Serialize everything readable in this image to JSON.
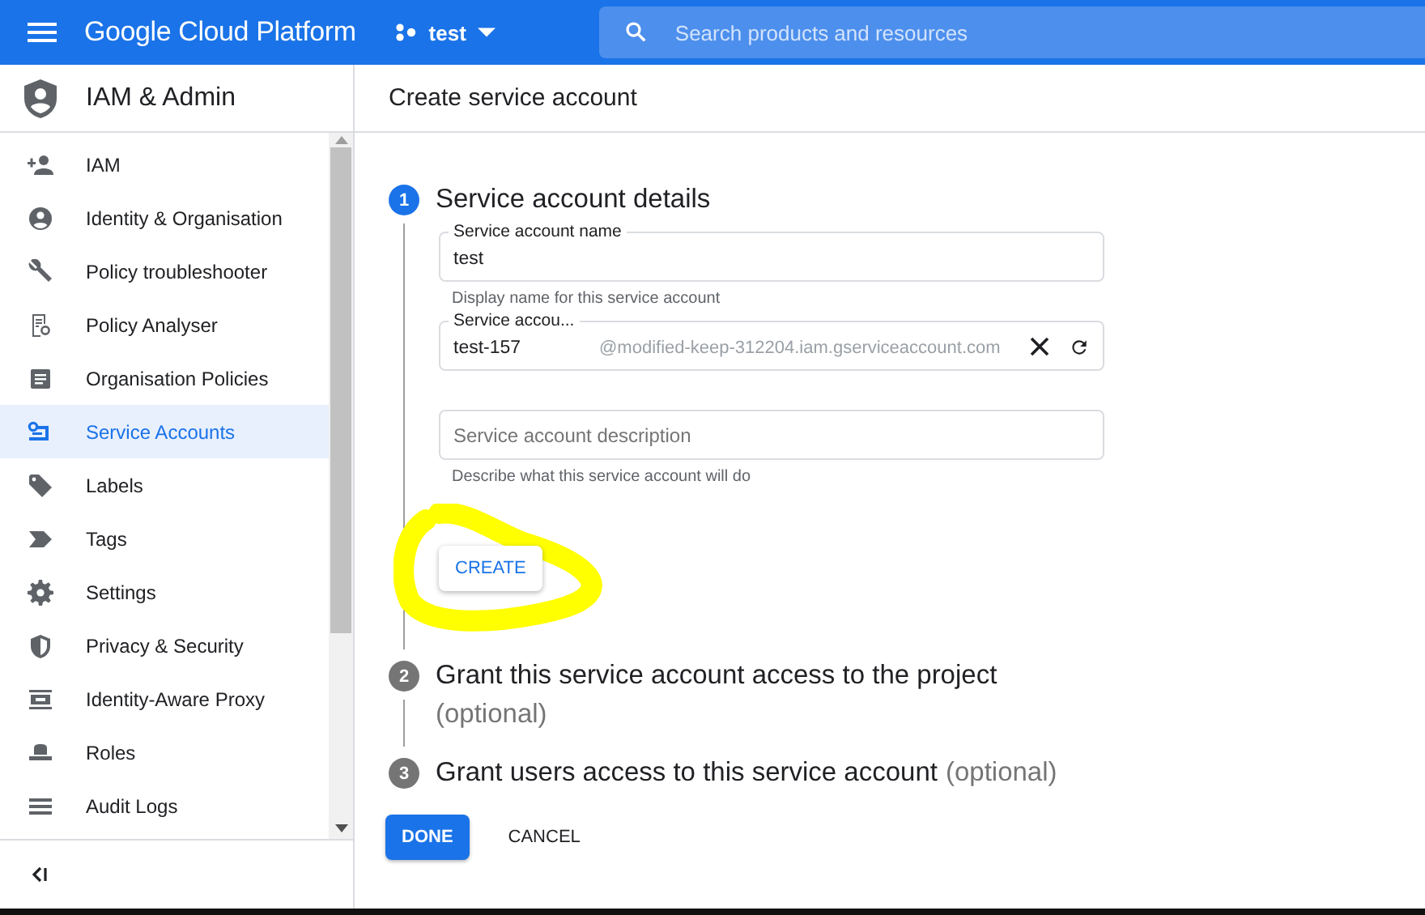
{
  "topbar": {
    "product": "Google Cloud Platform",
    "project": "test",
    "search": {
      "placeholder": "Search products and resources"
    }
  },
  "sidebar": {
    "title": "IAM & Admin",
    "items": [
      {
        "label": "IAM",
        "selected": false
      },
      {
        "label": "Identity & Organisation",
        "selected": false
      },
      {
        "label": "Policy troubleshooter",
        "selected": false
      },
      {
        "label": "Policy Analyser",
        "selected": false
      },
      {
        "label": "Organisation Policies",
        "selected": false
      },
      {
        "label": "Service Accounts",
        "selected": true
      },
      {
        "label": "Labels",
        "selected": false
      },
      {
        "label": "Tags",
        "selected": false
      },
      {
        "label": "Settings",
        "selected": false
      },
      {
        "label": "Privacy & Security",
        "selected": false
      },
      {
        "label": "Identity-Aware Proxy",
        "selected": false
      },
      {
        "label": "Roles",
        "selected": false
      },
      {
        "label": "Audit Logs",
        "selected": false
      }
    ]
  },
  "page": {
    "title": "Create service account"
  },
  "steps": [
    {
      "number": "1",
      "title": "Service account details",
      "active": true,
      "fields": [
        {
          "kind": "text",
          "label": "Service account name",
          "value": "test",
          "hint": "Display name for this service account"
        },
        {
          "kind": "id",
          "label": "Service accou...",
          "value": "test-157",
          "suffix": "@modified-keep-312204.iam.gserviceaccount.com"
        },
        {
          "kind": "text",
          "placeholder": "Service account description",
          "hint": "Describe what this service account will do"
        }
      ],
      "button": "CREATE"
    },
    {
      "number": "2",
      "title": "Grant this service account access to the project",
      "optional": "(optional)",
      "active": false
    },
    {
      "number": "3",
      "title": "Grant users access to this service account",
      "optional": "(optional)",
      "active": false
    }
  ],
  "actions": {
    "done": "DONE",
    "cancel": "CANCEL"
  }
}
